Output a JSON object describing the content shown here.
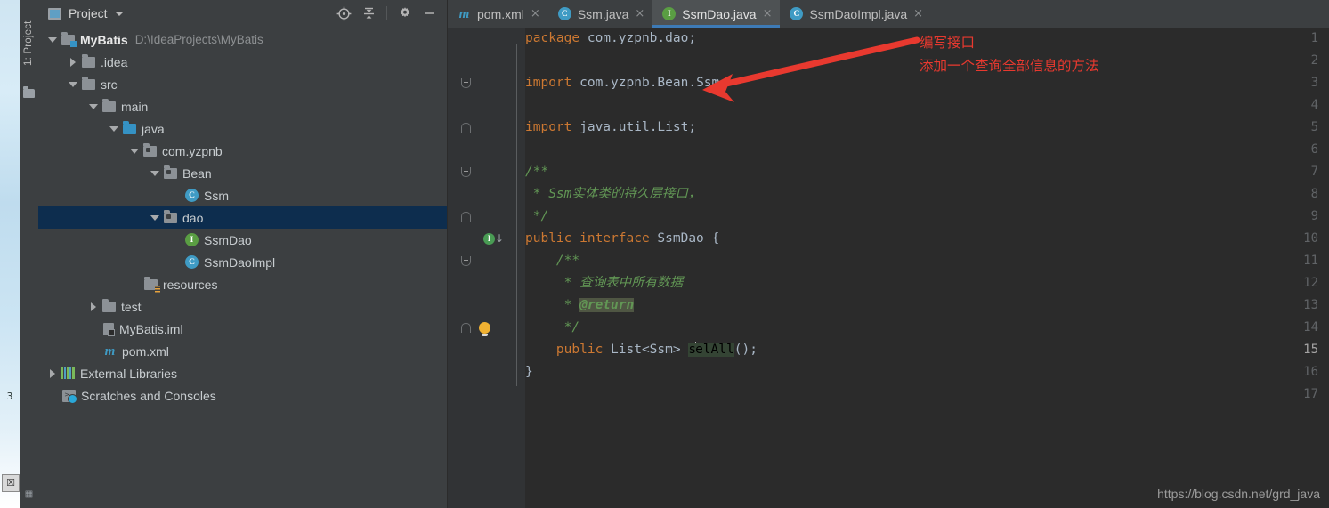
{
  "desktop": {
    "icons": [
      {
        "name": "partial-desktop-icon-top",
        "glyph": "3"
      },
      {
        "name": "partial-desktop-icon-bottom",
        "glyph": "☒"
      }
    ]
  },
  "toolwindow_strip": {
    "project_tab": "1: Project",
    "folder_icon": "folder-icon",
    "bottom_icon": "▦"
  },
  "project_panel": {
    "title": "Project",
    "title_icon": "project-view-icon",
    "caret_icon": "chevron-down-icon",
    "tools": [
      {
        "name": "locate-icon",
        "title": "Select Opened File"
      },
      {
        "name": "collapse-all-icon",
        "title": "Collapse All"
      },
      {
        "name": "gear-icon",
        "title": "Settings"
      },
      {
        "name": "minimize-icon",
        "title": "Hide"
      }
    ],
    "tree": [
      {
        "label": "MyBatis",
        "path": "D:\\IdeaProjects\\MyBatis",
        "indent": 0,
        "twisty": "open",
        "icon": "module-folder",
        "bold": true,
        "selected": false
      },
      {
        "label": ".idea",
        "path": "",
        "indent": 1,
        "twisty": "closed",
        "icon": "folder",
        "bold": false,
        "selected": false
      },
      {
        "label": "src",
        "path": "",
        "indent": 1,
        "twisty": "open",
        "icon": "folder",
        "bold": false,
        "selected": false
      },
      {
        "label": "main",
        "path": "",
        "indent": 2,
        "twisty": "open",
        "icon": "folder",
        "bold": false,
        "selected": false
      },
      {
        "label": "java",
        "path": "",
        "indent": 3,
        "twisty": "open",
        "icon": "source-folder",
        "bold": false,
        "selected": false
      },
      {
        "label": "com.yzpnb",
        "path": "",
        "indent": 4,
        "twisty": "open",
        "icon": "package",
        "bold": false,
        "selected": false
      },
      {
        "label": "Bean",
        "path": "",
        "indent": 5,
        "twisty": "open",
        "icon": "package",
        "bold": false,
        "selected": false
      },
      {
        "label": "Ssm",
        "path": "",
        "indent": 6,
        "twisty": "none",
        "icon": "class",
        "bold": false,
        "selected": false
      },
      {
        "label": "dao",
        "path": "",
        "indent": 5,
        "twisty": "open",
        "icon": "package",
        "bold": false,
        "selected": true
      },
      {
        "label": "SsmDao",
        "path": "",
        "indent": 6,
        "twisty": "none",
        "icon": "interface",
        "bold": false,
        "selected": false
      },
      {
        "label": "SsmDaoImpl",
        "path": "",
        "indent": 6,
        "twisty": "none",
        "icon": "class",
        "bold": false,
        "selected": false
      },
      {
        "label": "resources",
        "path": "",
        "indent": 4,
        "twisty": "none",
        "icon": "resource-folder",
        "bold": false,
        "selected": false
      },
      {
        "label": "test",
        "path": "",
        "indent": 2,
        "twisty": "closed",
        "icon": "folder",
        "bold": false,
        "selected": false
      },
      {
        "label": "MyBatis.iml",
        "path": "",
        "indent": 2,
        "twisty": "none",
        "icon": "iml-file",
        "bold": false,
        "selected": false
      },
      {
        "label": "pom.xml",
        "path": "",
        "indent": 2,
        "twisty": "none",
        "icon": "maven-file",
        "bold": false,
        "selected": false
      },
      {
        "label": "External Libraries",
        "path": "",
        "indent": 0,
        "twisty": "closed",
        "icon": "libraries",
        "bold": false,
        "selected": false
      },
      {
        "label": "Scratches and Consoles",
        "path": "",
        "indent": 0,
        "twisty": "none",
        "icon": "scratches",
        "bold": false,
        "selected": false
      }
    ]
  },
  "editor": {
    "tabs": [
      {
        "label": "pom.xml",
        "icon": "maven-file-icon",
        "active": false,
        "close": "×"
      },
      {
        "label": "Ssm.java",
        "icon": "class-icon",
        "active": false,
        "close": "×"
      },
      {
        "label": "SsmDao.java",
        "icon": "interface-icon",
        "active": true,
        "close": "×"
      },
      {
        "label": "SsmDaoImpl.java",
        "icon": "class-icon",
        "active": false,
        "close": "×"
      }
    ],
    "lines": [
      {
        "n": "1",
        "segments": [
          {
            "t": "package",
            "c": "k"
          },
          {
            "t": " com.yzpnb.dao;",
            "c": "id"
          }
        ],
        "fold": "",
        "marker": ""
      },
      {
        "n": "2",
        "segments": [],
        "fold": "",
        "marker": ""
      },
      {
        "n": "3",
        "segments": [
          {
            "t": "import",
            "c": "k"
          },
          {
            "t": " com.yzpnb.Bean.Ssm;",
            "c": "id"
          }
        ],
        "fold": "open",
        "marker": ""
      },
      {
        "n": "4",
        "segments": [],
        "fold": "",
        "marker": ""
      },
      {
        "n": "5",
        "segments": [
          {
            "t": "import",
            "c": "k"
          },
          {
            "t": " java.util.List;",
            "c": "id"
          }
        ],
        "fold": "close",
        "marker": ""
      },
      {
        "n": "6",
        "segments": [],
        "fold": "",
        "marker": ""
      },
      {
        "n": "7",
        "segments": [
          {
            "t": "/**",
            "c": "cm"
          }
        ],
        "fold": "open",
        "marker": ""
      },
      {
        "n": "8",
        "segments": [
          {
            "t": " * Ssm实体类的持久层接口，",
            "c": "cm"
          }
        ],
        "fold": "",
        "marker": ""
      },
      {
        "n": "9",
        "segments": [
          {
            "t": " */",
            "c": "cm"
          }
        ],
        "fold": "close",
        "marker": ""
      },
      {
        "n": "10",
        "segments": [
          {
            "t": "public interface ",
            "c": "k"
          },
          {
            "t": "SsmDao {",
            "c": "id"
          }
        ],
        "fold": "",
        "marker": "impl"
      },
      {
        "n": "11",
        "segments": [
          {
            "t": "    /**",
            "c": "cm"
          }
        ],
        "fold": "open",
        "marker": ""
      },
      {
        "n": "12",
        "segments": [
          {
            "t": "     * 查询表中所有数据",
            "c": "cm"
          }
        ],
        "fold": "",
        "marker": ""
      },
      {
        "n": "13",
        "segments": [
          {
            "t": "     * ",
            "c": "cm"
          },
          {
            "t": "@return",
            "c": "tag"
          }
        ],
        "fold": "",
        "marker": ""
      },
      {
        "n": "14",
        "segments": [
          {
            "t": "     */",
            "c": "cm"
          }
        ],
        "fold": "close",
        "marker": "bulb"
      },
      {
        "n": "15",
        "segments": [
          {
            "t": "    public ",
            "c": "k"
          },
          {
            "t": "List<Ssm> ",
            "c": "id"
          },
          {
            "t": "s",
            "c": "hl"
          },
          {
            "t": "CARET",
            "c": "caret"
          },
          {
            "t": "elAll",
            "c": "hl"
          },
          {
            "t": "();",
            "c": "id"
          }
        ],
        "fold": "",
        "marker": "",
        "current": true
      },
      {
        "n": "16",
        "segments": [
          {
            "t": "}",
            "c": "id"
          }
        ],
        "fold": "",
        "marker": ""
      },
      {
        "n": "17",
        "segments": [],
        "fold": "",
        "marker": ""
      }
    ]
  },
  "annotation": {
    "line1": "编写接口",
    "line2": "添加一个查询全部信息的方法",
    "color": "#e8392f",
    "arrow_name": "red-arrow-annotation"
  },
  "watermark": {
    "text": "https://blog.csdn.net/grd_java"
  }
}
